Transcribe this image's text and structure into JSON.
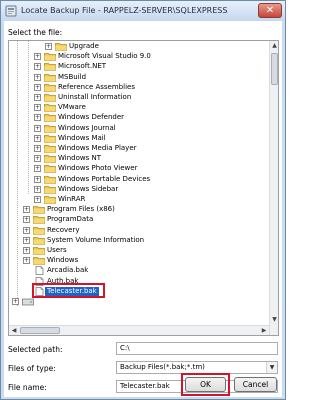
{
  "window": {
    "title": "Locate Backup File - RAPPELZ-SERVER\\SQLEXPRESS",
    "close_label": "✕"
  },
  "select_label": "Select the file:",
  "tree": {
    "items": [
      {
        "label": "Upgrade",
        "indent": 3,
        "expander": "+",
        "icon": "folder"
      },
      {
        "label": "Microsoft Visual Studio 9.0",
        "indent": 2,
        "expander": "+",
        "icon": "folder"
      },
      {
        "label": "Microsoft.NET",
        "indent": 2,
        "expander": "+",
        "icon": "folder"
      },
      {
        "label": "MSBuild",
        "indent": 2,
        "expander": "+",
        "icon": "folder"
      },
      {
        "label": "Reference Assemblies",
        "indent": 2,
        "expander": "+",
        "icon": "folder"
      },
      {
        "label": "Uninstall Information",
        "indent": 2,
        "expander": "+",
        "icon": "folder"
      },
      {
        "label": "VMware",
        "indent": 2,
        "expander": "+",
        "icon": "folder"
      },
      {
        "label": "Windows Defender",
        "indent": 2,
        "expander": "+",
        "icon": "folder"
      },
      {
        "label": "Windows Journal",
        "indent": 2,
        "expander": "+",
        "icon": "folder"
      },
      {
        "label": "Windows Mail",
        "indent": 2,
        "expander": "+",
        "icon": "folder"
      },
      {
        "label": "Windows Media Player",
        "indent": 2,
        "expander": "+",
        "icon": "folder"
      },
      {
        "label": "Windows NT",
        "indent": 2,
        "expander": "+",
        "icon": "folder"
      },
      {
        "label": "Windows Photo Viewer",
        "indent": 2,
        "expander": "+",
        "icon": "folder"
      },
      {
        "label": "Windows Portable Devices",
        "indent": 2,
        "expander": "+",
        "icon": "folder"
      },
      {
        "label": "Windows Sidebar",
        "indent": 2,
        "expander": "+",
        "icon": "folder"
      },
      {
        "label": "WinRAR",
        "indent": 2,
        "expander": "+",
        "icon": "folder"
      },
      {
        "label": "Program Files (x86)",
        "indent": 1,
        "expander": "+",
        "icon": "folder"
      },
      {
        "label": "ProgramData",
        "indent": 1,
        "expander": "+",
        "icon": "folder"
      },
      {
        "label": "Recovery",
        "indent": 1,
        "expander": "+",
        "icon": "folder"
      },
      {
        "label": "System Volume Information",
        "indent": 1,
        "expander": "+",
        "icon": "folder"
      },
      {
        "label": "Users",
        "indent": 1,
        "expander": "+",
        "icon": "folder"
      },
      {
        "label": "Windows",
        "indent": 1,
        "expander": "+",
        "icon": "folder"
      },
      {
        "label": "Arcadia.bak",
        "indent": 1,
        "expander": "",
        "icon": "file"
      },
      {
        "label": "Auth.bak",
        "indent": 1,
        "expander": "",
        "icon": "file"
      },
      {
        "label": "Telecaster.bak",
        "indent": 1,
        "expander": "",
        "icon": "file",
        "selected": true
      },
      {
        "label": "",
        "indent": 0,
        "expander": "+",
        "icon": "drive"
      }
    ]
  },
  "fields": {
    "selected_path_label": "Selected path:",
    "selected_path_value": "C:\\",
    "files_of_type_label": "Files of type:",
    "files_of_type_value": "Backup Files(*.bak;*.tm)",
    "file_name_label": "File name:",
    "file_name_value": "Telecaster.bak"
  },
  "buttons": {
    "ok": "OK",
    "cancel": "Cancel"
  },
  "colors": {
    "highlight_border": "#d2152b",
    "selection": "#1e63c6",
    "folder": "#f2c84b"
  }
}
